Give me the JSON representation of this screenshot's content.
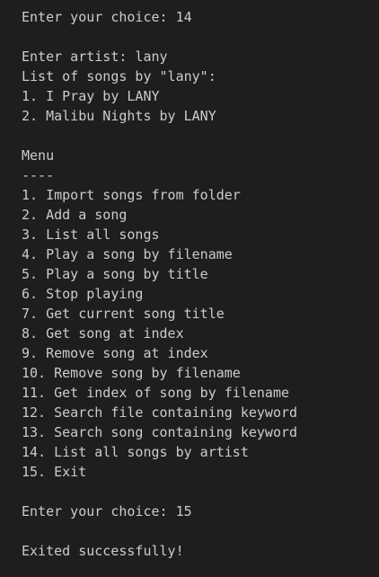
{
  "terminal": {
    "lines": [
      "Enter your choice: 14",
      "",
      "Enter artist: lany",
      "List of songs by \"lany\":",
      "1. I Pray by LANY",
      "2. Malibu Nights by LANY",
      "",
      "Menu",
      "----",
      "1. Import songs from folder",
      "2. Add a song",
      "3. List all songs",
      "4. Play a song by filename",
      "5. Play a song by title",
      "6. Stop playing",
      "7. Get current song title",
      "8. Get song at index",
      "9. Remove song at index",
      "10. Remove song by filename",
      "11. Get index of song by filename",
      "12. Search file containing keyword",
      "13. Search song containing keyword",
      "14. List all songs by artist",
      "15. Exit",
      "",
      "Enter your choice: 15",
      "",
      "Exited successfully!"
    ]
  }
}
